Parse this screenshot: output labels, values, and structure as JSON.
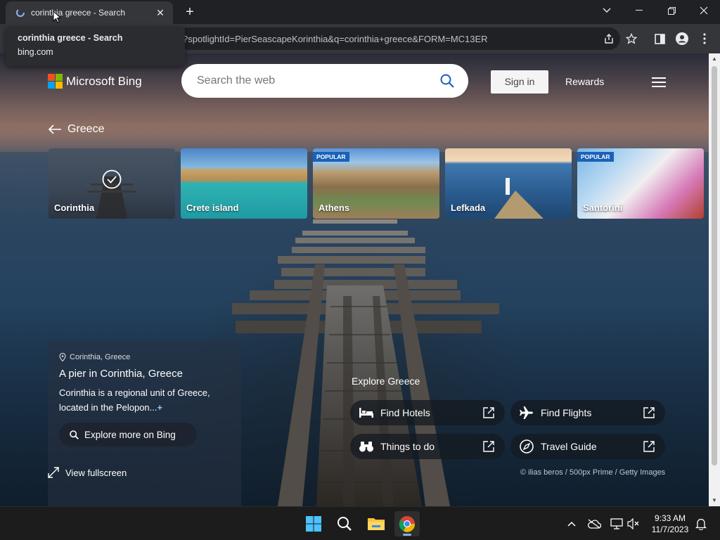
{
  "browser": {
    "tab_title": "corinthia greece - Search",
    "tooltip": {
      "title": "corinthia greece - Search",
      "domain": "bing.com"
    },
    "url": "?spotlightId=PierSeascapeKorinthia&q=corinthia+greece&FORM=MC13ER"
  },
  "header": {
    "brand": "Microsoft Bing",
    "search_placeholder": "Search the web",
    "signin_label": "Sign in",
    "rewards_label": "Rewards"
  },
  "back_label": "Greece",
  "cards": [
    {
      "label": "Corinthia",
      "badge": "",
      "selected": true
    },
    {
      "label": "Crete island",
      "badge": ""
    },
    {
      "label": "Athens",
      "badge": "POPULAR"
    },
    {
      "label": "Lefkada",
      "badge": ""
    },
    {
      "label": "Santorini",
      "badge": "POPULAR"
    }
  ],
  "info": {
    "location": "Corinthia, Greece",
    "title": "A pier in Corinthia, Greece",
    "description": "Corinthia is a regional unit of Greece, located in the Pelopon...",
    "more_symbol": "+",
    "explore_button": "Explore more on Bing"
  },
  "fullscreen_label": "View fullscreen",
  "explore": {
    "title": "Explore Greece",
    "links": [
      {
        "label": "Find Hotels",
        "icon": "bed-icon"
      },
      {
        "label": "Find Flights",
        "icon": "plane-icon"
      },
      {
        "label": "Things to do",
        "icon": "binoculars-icon"
      },
      {
        "label": "Travel Guide",
        "icon": "compass-icon"
      }
    ]
  },
  "credit": "© ilias beros / 500px Prime / Getty Images",
  "taskbar": {
    "time": "9:33 AM",
    "date": "11/7/2023"
  },
  "colors": {
    "bing_blue": "#1a62b8",
    "ms_red": "#f25022",
    "ms_green": "#7fba00",
    "ms_blue": "#00a4ef",
    "ms_yellow": "#ffb900"
  }
}
